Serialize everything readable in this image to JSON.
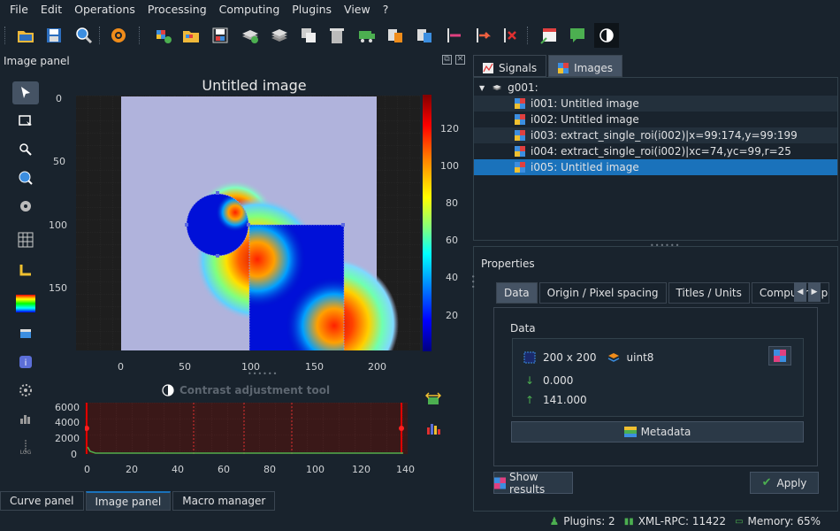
{
  "menubar": {
    "items": [
      "File",
      "Edit",
      "Operations",
      "Processing",
      "Computing",
      "Plugins",
      "View",
      "?"
    ]
  },
  "toolbar": {
    "icons": [
      "open-folder-icon",
      "save-icon",
      "search-icon",
      "settings-gear-icon",
      "new-image-icon",
      "open-image-icon",
      "save-image-icon",
      "add-layer-icon",
      "stack-icon",
      "duplicate-icon",
      "delete-icon",
      "move-icon",
      "copy-meta-icon",
      "paste-meta-icon",
      "roi-add-icon",
      "roi-move-icon",
      "roi-delete-icon",
      "annotation-icon",
      "comment-icon",
      "contrast-icon"
    ]
  },
  "image_panel": {
    "title": "Image panel",
    "plot_title": "Untitled image",
    "y_ticks": [
      "0",
      "50",
      "100",
      "150"
    ],
    "x_ticks": [
      "0",
      "50",
      "100",
      "150",
      "200"
    ],
    "colorbar_ticks": [
      "120",
      "100",
      "80",
      "60",
      "40",
      "20"
    ],
    "colorbar_range": [
      0,
      141
    ]
  },
  "contrast_tool": {
    "title": "Contrast adjustment tool",
    "y_ticks": [
      "6000",
      "4000",
      "2000",
      "0"
    ],
    "x_ticks": [
      "0",
      "20",
      "40",
      "60",
      "80",
      "100",
      "120",
      "140"
    ]
  },
  "bottom_tabs": [
    "Curve panel",
    "Image panel",
    "Macro manager"
  ],
  "right_tabs": [
    "Signals",
    "Images"
  ],
  "tree": {
    "group": "g001:",
    "items": [
      "i001: Untitled image",
      "i002: Untitled image",
      "i003: extract_single_roi(i002)|x=99:174,y=99:199",
      "i004: extract_single_roi(i002)|xc=74,yc=99,r=25",
      "i005: Untitled image"
    ]
  },
  "properties": {
    "title": "Properties",
    "tabs": [
      "Data",
      "Origin / Pixel spacing",
      "Titles / Units",
      "Computing para"
    ],
    "data_label": "Data",
    "size": "200 x 200",
    "dtype": "uint8",
    "min": "0.000",
    "max": "141.000",
    "metadata_label": "Metadata",
    "show_results_label": "Show results",
    "apply_label": "Apply"
  },
  "status": {
    "plugins": "Plugins: 2",
    "xmlrpc": "XML-RPC: 11422",
    "memory": "Memory: 65%"
  },
  "colors": {
    "background": "#19232d",
    "selection": "#1a72bb",
    "image_background": "#b0b3dc"
  }
}
